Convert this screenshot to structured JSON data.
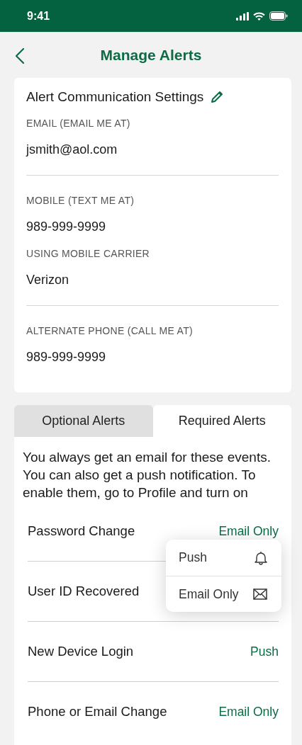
{
  "status_bar": {
    "time": "9:41"
  },
  "header": {
    "title": "Manage Alerts"
  },
  "settings": {
    "title": "Alert Communication Settings",
    "groups": [
      {
        "fields": [
          {
            "label": "EMAIL (EMAIL ME AT)",
            "value": "jsmith@aol.com"
          }
        ]
      },
      {
        "fields": [
          {
            "label": "MOBILE (TEXT ME AT)",
            "value": "989-999-9999"
          },
          {
            "label": "USING MOBILE CARRIER",
            "value": "Verizon"
          }
        ]
      },
      {
        "fields": [
          {
            "label": "ALTERNATE PHONE (CALL ME AT)",
            "value": "989-999-9999"
          }
        ]
      }
    ]
  },
  "tabs": [
    {
      "label": "Optional Alerts",
      "selected": false
    },
    {
      "label": "Required Alerts",
      "selected": true
    }
  ],
  "description": "You always get an email for these events. You can also get a push notification. To enable them, go to Profile and turn on",
  "alerts": [
    {
      "name": "Password Change",
      "value": "Email Only"
    },
    {
      "name": "User ID Recovered"
    },
    {
      "name": "New Device Login",
      "value": "Push"
    },
    {
      "name": "Phone or Email Change",
      "value": "Email Only"
    }
  ],
  "menu": {
    "items": [
      {
        "label": "Push",
        "kind": "push"
      },
      {
        "label": "Email Only",
        "kind": "email"
      }
    ]
  }
}
